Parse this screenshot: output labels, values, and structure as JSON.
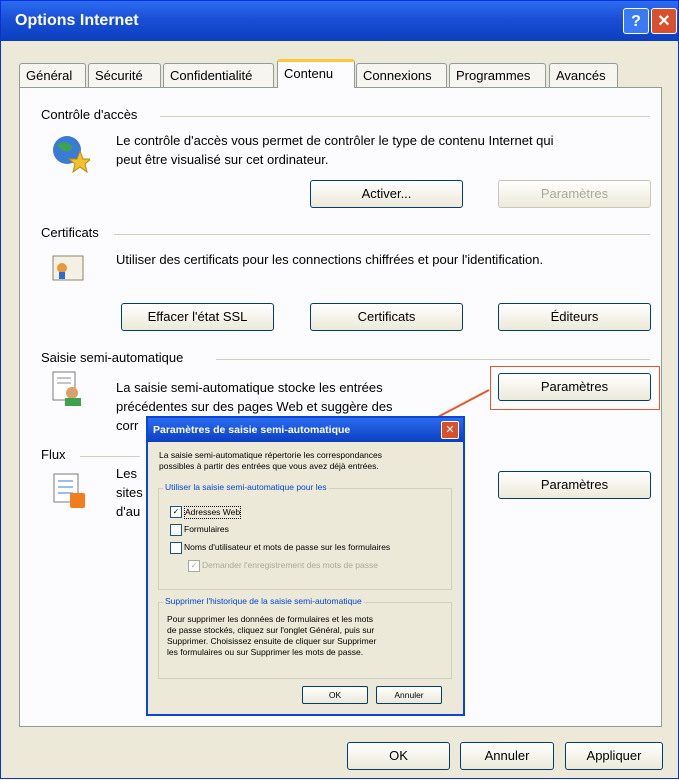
{
  "window": {
    "title": "Options Internet",
    "help_label": "?",
    "close_label": "✕"
  },
  "tabs": [
    "Général",
    "Sécurité",
    "Confidentialité",
    "Contenu",
    "Connexions",
    "Programmes",
    "Avancés"
  ],
  "controle": {
    "title": "Contrôle d'accès",
    "desc1": "Le contrôle d'accès vous permet de contrôler le type de contenu Internet qui",
    "desc2": "peut être visualisé sur cet ordinateur.",
    "activer": "Activer...",
    "parametres": "Paramètres"
  },
  "certificats": {
    "title": "Certificats",
    "desc": "Utiliser des certificats pour les connections chiffrées et pour l'identification.",
    "effacer": "Effacer l'état SSL",
    "certificats": "Certificats",
    "editeurs": "Éditeurs"
  },
  "saisie": {
    "title": "Saisie semi-automatique",
    "desc1": "La saisie semi-automatique stocke les entrées",
    "desc2": "précédentes sur des pages Web et suggère des",
    "desc3": "corr",
    "parametres": "Paramètres"
  },
  "flux": {
    "title": "Flux",
    "desc1": "Les",
    "desc2": "sites",
    "desc3": "d'au",
    "parametres": "Paramètres"
  },
  "footer": {
    "ok": "OK",
    "annuler": "Annuler",
    "appliquer": "Appliquer"
  },
  "dialog": {
    "title": "Paramètres de saisie semi-automatique",
    "close_label": "✕",
    "intro1": "La saisie semi-automatique répertorie les correspondances",
    "intro2": "possibles à partir des entrées que vous avez déjà entrées.",
    "group1_legend": "Utiliser la saisie semi-automatique pour les",
    "cb_adresses": "Adresses Web",
    "cb_formulaires": "Formulaires",
    "cb_noms": "Noms d'utilisateur et mots de passe sur les formulaires",
    "cb_demander": "Demander l'enregistrement des mots de passe",
    "group2_legend": "Supprimer l'historique de la saisie semi-automatique",
    "hist1": "Pour supprimer les données de formulaires et les mots",
    "hist2": "de passe stockés, cliquez sur l'onglet Général, puis sur",
    "hist3": "Supprimer. Choisissez ensuite de cliquer sur Supprimer",
    "hist4": "les formulaires ou sur Supprimer les mots de passe.",
    "ok": "OK",
    "annuler": "Annuler"
  },
  "colors": {
    "titlebar": "#0b3fc0",
    "highlight": "#e8562a"
  }
}
